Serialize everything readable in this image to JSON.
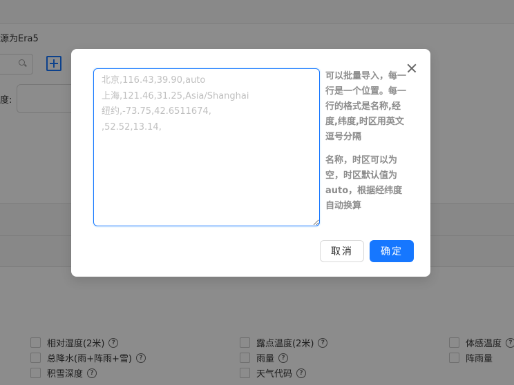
{
  "background": {
    "source_text": "源为Era5",
    "field_label": "度:",
    "checkboxes": [
      {
        "label": "相对湿度(2米)"
      },
      {
        "label": "露点温度(2米)"
      },
      {
        "label": "体感温度"
      },
      {
        "label": "总降水(雨+阵雨+雪)"
      },
      {
        "label": "雨量"
      },
      {
        "label": "阵雨量"
      },
      {
        "label": "积雪深度"
      },
      {
        "label": "天气代码"
      }
    ]
  },
  "modal": {
    "textarea_placeholder": "北京,116.43,39.90,auto\n上海,121.46,31.25,Asia/Shanghai\n纽约,-73.75,42.6511674,\n,52.52,13.14,",
    "hint_p1": "可以批量导入，每一行是一个位置。每一行的格式是名称,经度,纬度,时区用英文逗号分隔",
    "hint_p2": "名称，时区可以为空，时区默认值为auto，根据经纬度自动换算",
    "cancel_label": "取消",
    "ok_label": "确定"
  },
  "icons": {
    "close": "close-icon",
    "search": "search-icon",
    "add": "plus-square-icon",
    "help": "question-circle-icon"
  },
  "colors": {
    "primary": "#1677ff",
    "mask": "rgba(0,0,0,0.45)"
  }
}
